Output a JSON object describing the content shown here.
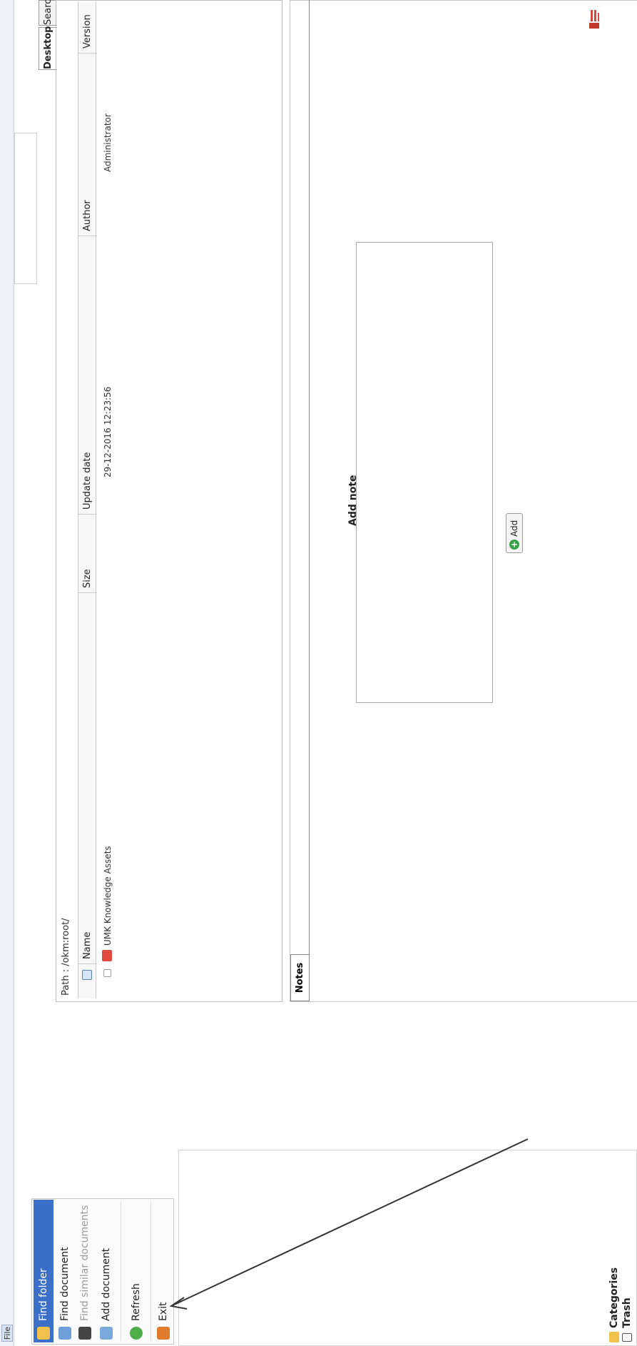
{
  "menu": {
    "file_label": "File"
  },
  "dropdown": {
    "items": [
      {
        "label": "Find folder",
        "state": "highlighted"
      },
      {
        "label": "Find document",
        "state": "normal"
      },
      {
        "label": "Find similar documents",
        "state": "disabled"
      },
      {
        "label": "Add document",
        "state": "normal"
      },
      {
        "label": "Refresh",
        "state": "normal"
      },
      {
        "label": "Exit",
        "state": "normal"
      }
    ]
  },
  "tabs": {
    "desktop": "Desktop",
    "search": "Search"
  },
  "browser": {
    "path": "Path : /okm:root/",
    "columns": {
      "name": "Name",
      "size": "Size",
      "updated": "Update date",
      "author": "Author",
      "version": "Version"
    },
    "rows": [
      {
        "name": "UMK Knowledge Assets",
        "size": "",
        "updated": "29-12-2016 12:23:56",
        "author": "Administrator",
        "version": ""
      }
    ]
  },
  "notes": {
    "tab_label": "Notes",
    "title": "Add note",
    "add_button": "Add"
  },
  "left_bottom": {
    "categories": "Categories",
    "trash": "Trash"
  },
  "colors": {
    "highlight": "#3b6fc8",
    "folder_icon": "#e04a3f",
    "add_icon": "#37a045"
  }
}
